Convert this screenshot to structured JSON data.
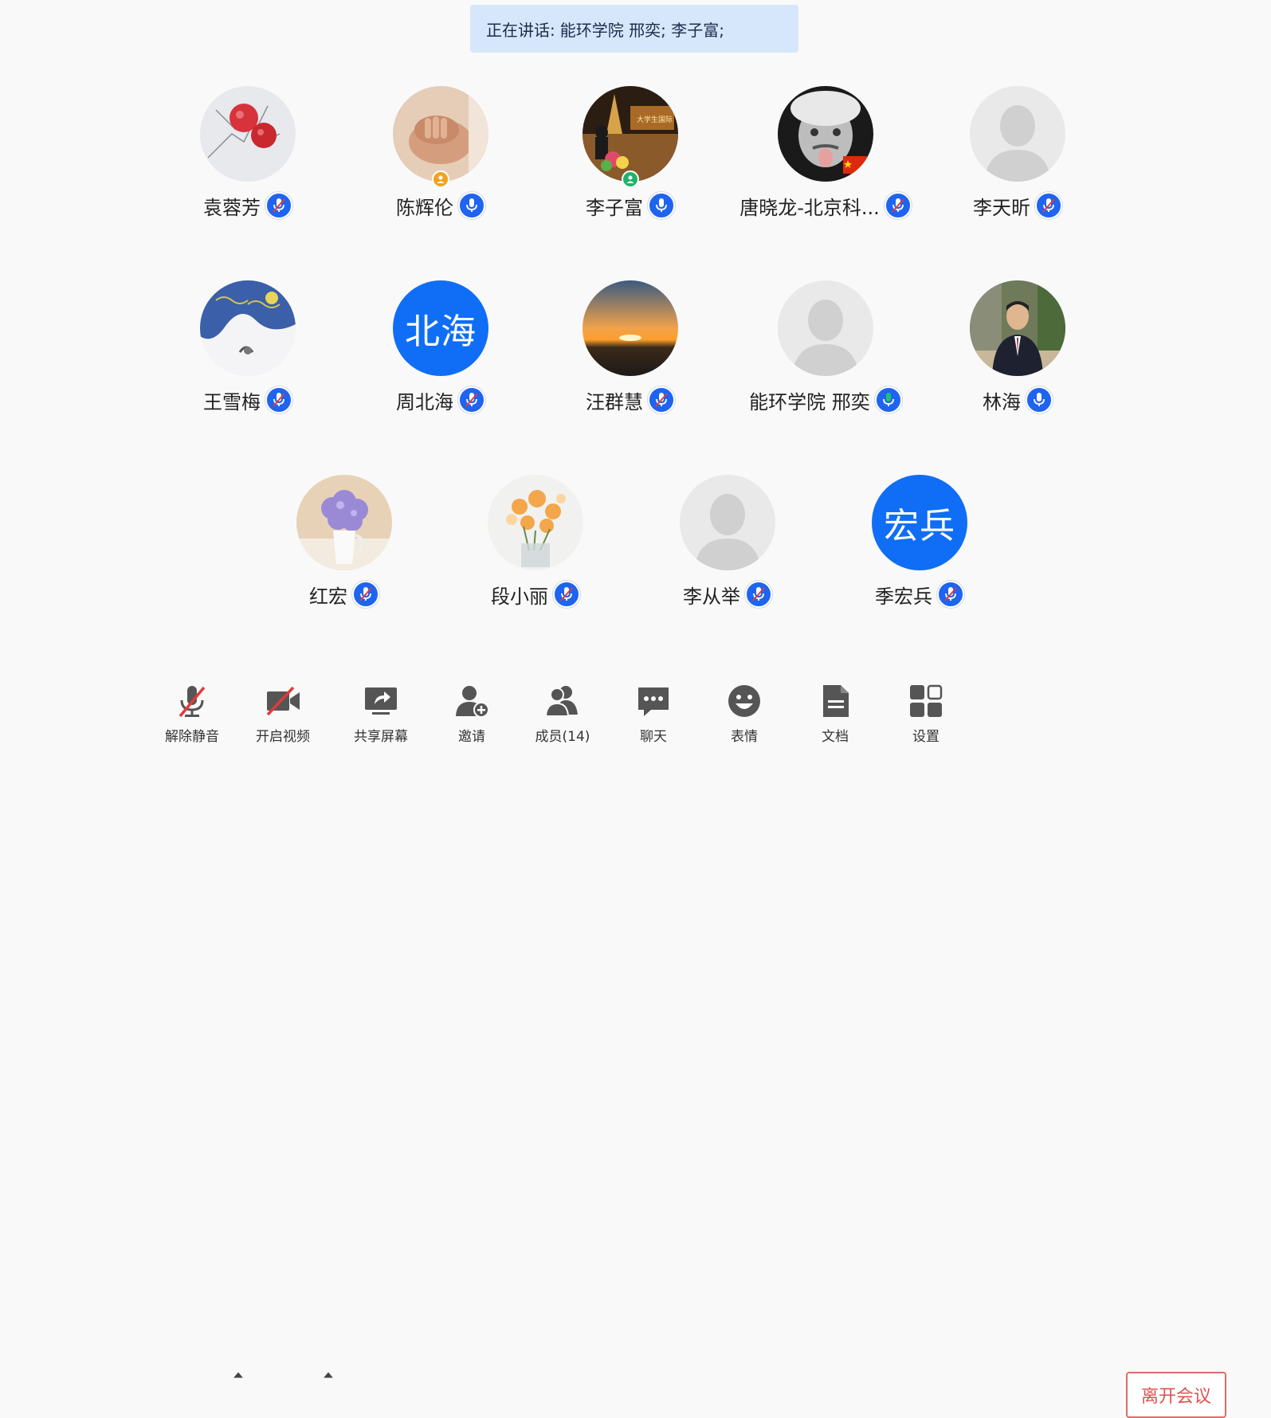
{
  "banner": {
    "prefix": "正在讲话:",
    "speakers": "能环学院 邢奕; 李子富;"
  },
  "participants": [
    {
      "name": "袁蓉芳",
      "muted": true
    },
    {
      "name": "陈辉伦",
      "muted": false
    },
    {
      "name": "李子富",
      "muted": false
    },
    {
      "name": "唐晓龙-北京科...",
      "muted": true
    },
    {
      "name": "李天昕",
      "muted": true
    },
    {
      "name": "王雪梅",
      "muted": true
    },
    {
      "name": "周北海",
      "initials": "北海",
      "muted": true
    },
    {
      "name": "汪群慧",
      "muted": true
    },
    {
      "name": "能环学院 邢奕",
      "muted": false,
      "speaking": true
    },
    {
      "name": "林海",
      "muted": false
    },
    {
      "name": "红宏",
      "muted": true
    },
    {
      "name": "段小丽",
      "muted": true
    },
    {
      "name": "李从举",
      "muted": true
    },
    {
      "name": "季宏兵",
      "initials": "宏兵",
      "muted": true
    }
  ],
  "toolbar": {
    "unmute": "解除静音",
    "start_video": "开启视频",
    "share_screen": "共享屏幕",
    "invite": "邀请",
    "members": "成员(14)",
    "chat": "聊天",
    "emoji": "表情",
    "docs": "文档",
    "settings": "设置",
    "leave": "离开会议"
  },
  "colors": {
    "accent": "#1e64f0",
    "initials_bg": "#0f6ef5",
    "banner_bg": "#d6e7fb",
    "leave": "#e05050",
    "speaking": "#21c46b"
  }
}
